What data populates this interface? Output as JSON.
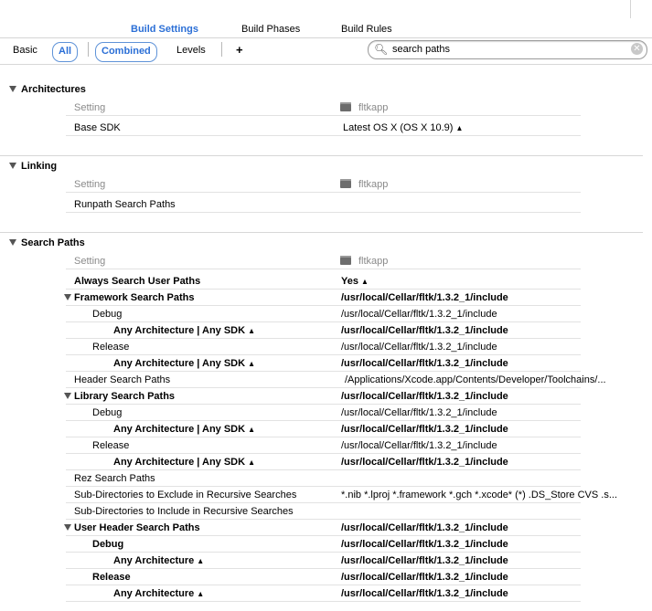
{
  "tabs": {
    "build_settings": "Build Settings",
    "build_phases": "Build Phases",
    "build_rules": "Build Rules"
  },
  "filter": {
    "basic": "Basic",
    "all": "All",
    "combined": "Combined",
    "levels": "Levels",
    "add": "+",
    "search_value": "search paths"
  },
  "target_name": "fltkapp",
  "setting_header": "Setting",
  "architectures": {
    "title": "Architectures",
    "base_sdk_label": "Base SDK",
    "base_sdk_value": "Latest OS X (OS X 10.9)"
  },
  "linking": {
    "title": "Linking",
    "runpath_label": "Runpath Search Paths"
  },
  "search_paths": {
    "title": "Search Paths",
    "rows": [
      {
        "label": "Always Search User Paths",
        "value": "Yes",
        "bold": true,
        "indent": 0,
        "tri": false,
        "stepper": true
      },
      {
        "label": "Framework Search Paths",
        "value": "/usr/local/Cellar/fltk/1.3.2_1/include",
        "bold": true,
        "indent": 0,
        "tri": true,
        "vbold": true
      },
      {
        "label": "Debug",
        "value": "/usr/local/Cellar/fltk/1.3.2_1/include",
        "bold": false,
        "indent": 20
      },
      {
        "label": "Any Architecture | Any SDK",
        "value": "/usr/local/Cellar/fltk/1.3.2_1/include",
        "bold": true,
        "indent": 43,
        "stepper": true,
        "vbold": true
      },
      {
        "label": "Release",
        "value": "/usr/local/Cellar/fltk/1.3.2_1/include",
        "bold": false,
        "indent": 20
      },
      {
        "label": "Any Architecture | Any SDK",
        "value": "/usr/local/Cellar/fltk/1.3.2_1/include",
        "bold": true,
        "indent": 43,
        "stepper": true,
        "vbold": true
      },
      {
        "label": "Header Search Paths",
        "value": "/Applications/Xcode.app/Contents/Developer/Toolchains/...",
        "bold": false,
        "indent": 0,
        "voffset": 4
      },
      {
        "label": "Library Search Paths",
        "value": "/usr/local/Cellar/fltk/1.3.2_1/include",
        "bold": true,
        "indent": 0,
        "tri": true,
        "vbold": true
      },
      {
        "label": "Debug",
        "value": "/usr/local/Cellar/fltk/1.3.2_1/include",
        "bold": false,
        "indent": 20
      },
      {
        "label": "Any Architecture | Any SDK",
        "value": "/usr/local/Cellar/fltk/1.3.2_1/include",
        "bold": true,
        "indent": 43,
        "stepper": true,
        "vbold": true
      },
      {
        "label": "Release",
        "value": "/usr/local/Cellar/fltk/1.3.2_1/include",
        "bold": false,
        "indent": 20
      },
      {
        "label": "Any Architecture | Any SDK",
        "value": "/usr/local/Cellar/fltk/1.3.2_1/include",
        "bold": true,
        "indent": 43,
        "stepper": true,
        "vbold": true
      },
      {
        "label": "Rez Search Paths",
        "value": "",
        "bold": false,
        "indent": 0
      },
      {
        "label": "Sub-Directories to Exclude in Recursive Searches",
        "value": "*.nib *.lproj *.framework *.gch *.xcode* (*) .DS_Store CVS .s...",
        "bold": false,
        "indent": 0
      },
      {
        "label": "Sub-Directories to Include in Recursive Searches",
        "value": "",
        "bold": false,
        "indent": 0
      },
      {
        "label": "User Header Search Paths",
        "value": "/usr/local/Cellar/fltk/1.3.2_1/include",
        "bold": true,
        "indent": 0,
        "tri": true,
        "vbold": true
      },
      {
        "label": "Debug",
        "value": "/usr/local/Cellar/fltk/1.3.2_1/include",
        "bold": true,
        "indent": 20,
        "vbold": true
      },
      {
        "label": "Any Architecture",
        "value": "/usr/local/Cellar/fltk/1.3.2_1/include",
        "bold": true,
        "indent": 43,
        "stepper": true,
        "vbold": true
      },
      {
        "label": "Release",
        "value": "/usr/local/Cellar/fltk/1.3.2_1/include",
        "bold": true,
        "indent": 20,
        "vbold": true
      },
      {
        "label": "Any Architecture",
        "value": "/usr/local/Cellar/fltk/1.3.2_1/include",
        "bold": true,
        "indent": 43,
        "stepper": true,
        "vbold": true
      }
    ]
  }
}
